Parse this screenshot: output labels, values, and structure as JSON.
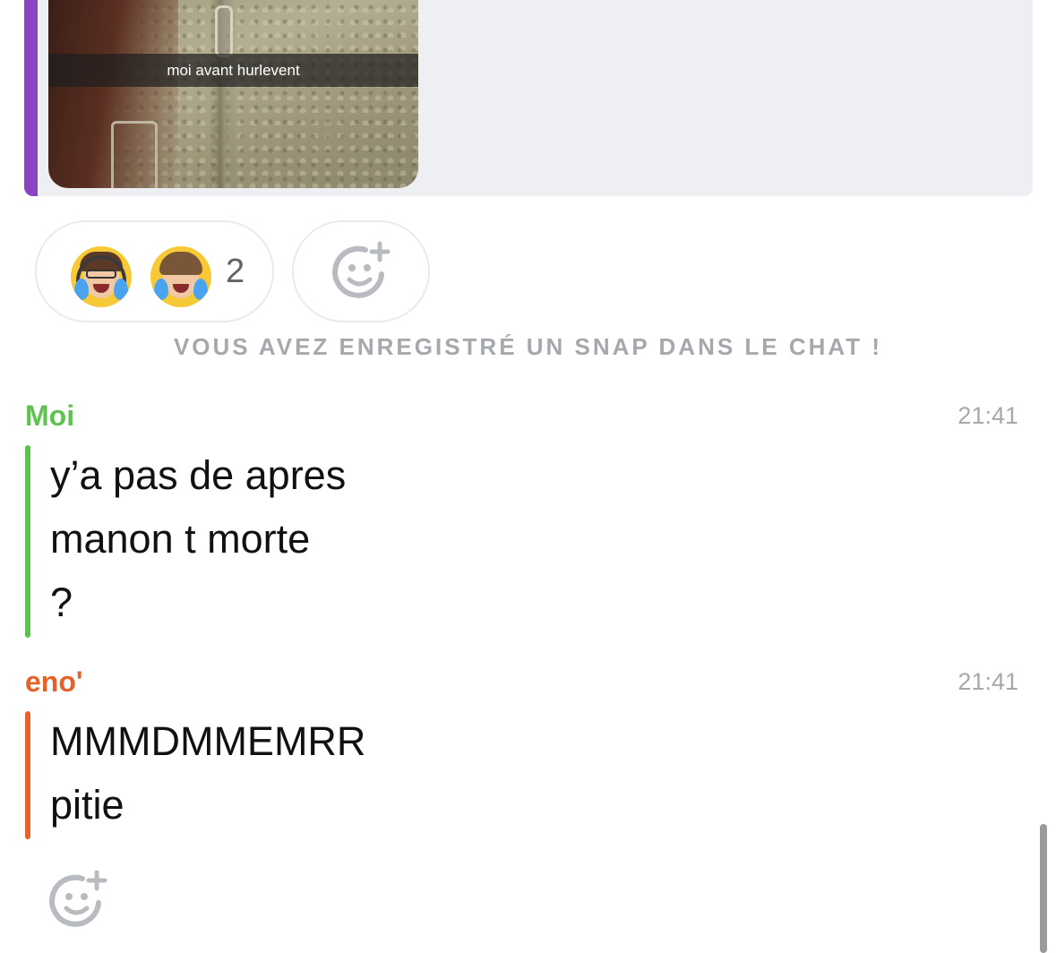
{
  "snap": {
    "caption": "moi avant hurlevent",
    "accent_color": "#8a44c1"
  },
  "reactions": {
    "avatars": [
      "bitmoji-crying-laughing-headset",
      "bitmoji-crying-laughing"
    ],
    "count": "2",
    "add_icon": "add-reaction-icon"
  },
  "notice": "VOUS AVEZ ENREGISTRÉ UN SNAP DANS LE CHAT !",
  "messages": [
    {
      "sender": "Moi",
      "time": "21:41",
      "color": "#5fc24f",
      "lines": [
        "y’a pas de apres",
        "manon t morte",
        "?"
      ]
    },
    {
      "sender": "eno'",
      "time": "21:41",
      "color": "#e5622b",
      "lines": [
        "MMMDMMEMRR",
        "pitie"
      ]
    }
  ]
}
